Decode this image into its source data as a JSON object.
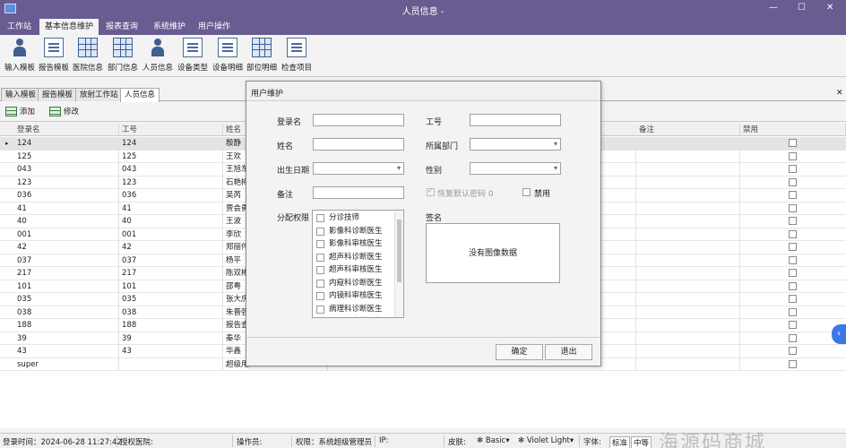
{
  "window": {
    "title": "人员信息 -"
  },
  "menu": [
    "工作站",
    "基本信息维护",
    "报表查询",
    "系统维护",
    "用户操作"
  ],
  "ribbon": [
    "输入模板",
    "报告模板",
    "医院信息",
    "部门信息",
    "人员信息",
    "设备类型",
    "设备明细",
    "部位明细",
    "检查项目"
  ],
  "doc_tabs": [
    "输入模板",
    "报告模板",
    "放射工作站",
    "人员信息"
  ],
  "toolbar": {
    "add": "添加",
    "edit": "修改"
  },
  "grid": {
    "columns": [
      "登录名",
      "工号",
      "姓名",
      "备注",
      "禁用"
    ],
    "rows": [
      {
        "login": "124",
        "no": "124",
        "name": "殷静"
      },
      {
        "login": "125",
        "no": "125",
        "name": "王欢"
      },
      {
        "login": "043",
        "no": "043",
        "name": "王旭东"
      },
      {
        "login": "123",
        "no": "123",
        "name": "石艳梅"
      },
      {
        "login": "036",
        "no": "036",
        "name": "吴芮"
      },
      {
        "login": "41",
        "no": "41",
        "name": "贾会勇"
      },
      {
        "login": "40",
        "no": "40",
        "name": "王波"
      },
      {
        "login": "001",
        "no": "001",
        "name": "李欣"
      },
      {
        "login": "42",
        "no": "42",
        "name": "郑丽伟"
      },
      {
        "login": "037",
        "no": "037",
        "name": "杨平"
      },
      {
        "login": "217",
        "no": "217",
        "name": "陈双彬"
      },
      {
        "login": "101",
        "no": "101",
        "name": "邵粤"
      },
      {
        "login": "035",
        "no": "035",
        "name": "张大庆"
      },
      {
        "login": "038",
        "no": "038",
        "name": "朱晋强"
      },
      {
        "login": "188",
        "no": "188",
        "name": "报告查"
      },
      {
        "login": "39",
        "no": "39",
        "name": "秦华"
      },
      {
        "login": "43",
        "no": "43",
        "name": "华鑫"
      },
      {
        "login": "super",
        "no": "",
        "name": "超级用户"
      }
    ]
  },
  "dialog": {
    "title": "用户维护",
    "fields": {
      "login": "登录名",
      "no": "工号",
      "name": "姓名",
      "dept": "所属部门",
      "birth": "出生日期",
      "gender": "性别",
      "remark": "备注",
      "reset_pwd": "恢复默认密码 0",
      "disabled": "禁用",
      "perm": "分配权限",
      "sign": "签名",
      "no_image": "没有图像数据"
    },
    "permissions": [
      "分诊技师",
      "影像科诊断医生",
      "影像科审核医生",
      "超声科诊断医生",
      "超声科审核医生",
      "内窥科诊断医生",
      "内镜科审核医生",
      "病理科诊断医生",
      "病理科审核医生"
    ],
    "ok": "确定",
    "cancel": "退出"
  },
  "status": {
    "login_time": "登录时间：2024-06-28 11:27:42",
    "hospital": "授权医院:",
    "operator": "操作员:",
    "role": "权限：系统超级管理员",
    "ip": "IP:",
    "skin_label": "皮肤:",
    "skin_value": "Basic",
    "theme": "Violet Light",
    "font_label": "字体:",
    "font_value": "标准",
    "size": "中等"
  },
  "watermark": "海源码商城"
}
